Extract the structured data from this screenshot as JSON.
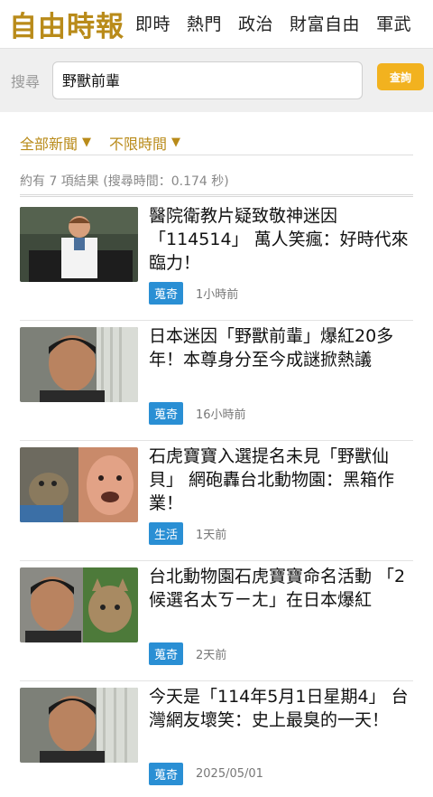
{
  "header": {
    "logo": "自由時報",
    "nav": [
      "即時",
      "熱門",
      "政治",
      "財富自由",
      "軍武"
    ]
  },
  "search": {
    "label": "搜尋",
    "value": "野獸前輩",
    "button": "查詢"
  },
  "filters": {
    "category": "全部新聞",
    "time_range": "不限時間",
    "caret": "▼"
  },
  "result_count": "約有 7 項結果 (搜尋時間：0.174 秒)",
  "results": [
    {
      "title": "醫院衛教片疑致敬神迷因「114514」 萬人笑瘋：好時代來臨力！",
      "category": "蒐奇",
      "time": "1小時前"
    },
    {
      "title": "日本迷因「野獸前輩」爆紅20多年！本尊身分至今成謎掀熱議",
      "category": "蒐奇",
      "time": "16小時前"
    },
    {
      "title": "石虎寶寶入選提名未見「野獸仙貝」 網砲轟台北動物園：黑箱作業！",
      "category": "生活",
      "time": "1天前"
    },
    {
      "title": "台北動物園石虎寶寶命名活動 「2候選名太ㄎㄧㄤ」在日本爆紅",
      "category": "蒐奇",
      "time": "2天前"
    },
    {
      "title": "今天是「114年5月1日星期4」 台灣網友壞笑：史上最臭的一天！",
      "category": "蒐奇",
      "time": "2025/05/01"
    }
  ],
  "colors": {
    "brand": "#b98b1a",
    "search_button": "#f2b21f",
    "category_badge": "#2a8fd4"
  }
}
